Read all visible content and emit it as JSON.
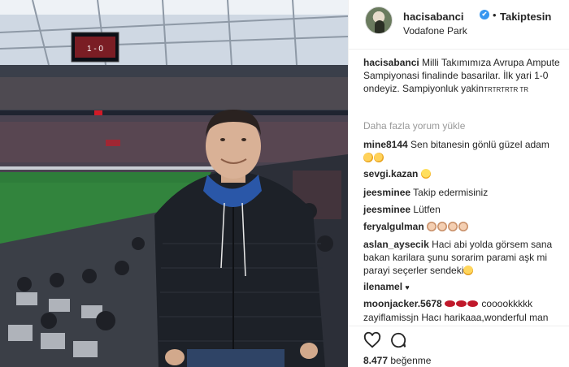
{
  "post": {
    "author": {
      "username": "hacisabanci",
      "follow_status": "Takiptesin",
      "separator": "•",
      "location": "Vodafone Park",
      "verified_badge": "✔"
    },
    "caption": {
      "username": "hacisabanci",
      "text": "Milli Takımımıza Avrupa Ampute Sampiyonasi finalinde basarilar. İlk yari 1-0 ondeyiz. Sampiyonluk yakin",
      "trailing_tags": "TRTRTRTR TR"
    },
    "load_more_comments": "Daha fazla yorum yükle",
    "comments": [
      {
        "username": "mine8144",
        "text": "Sen bitanesin gönlü güzel adam",
        "emoji": [
          "clap",
          "clap"
        ]
      },
      {
        "username": "sevgi.kazan",
        "text": "",
        "emoji": [
          "smile"
        ]
      },
      {
        "username": "jeesminee",
        "text": "Takip edermisiniz",
        "emoji": []
      },
      {
        "username": "jeesminee",
        "text": "Lütfen",
        "emoji": []
      },
      {
        "username": "feryalgulman",
        "text": "",
        "emoji": [
          "hands",
          "hands",
          "hands",
          "hands"
        ]
      },
      {
        "username": "aslan_aysecik",
        "text": "Haci abi yolda görsem sana bakan karilara şunu sorarim parami aşk mi parayi seçerler sendeki",
        "emoji": [
          "laugh"
        ]
      },
      {
        "username": "ilenamel",
        "text": "♥",
        "emoji": []
      },
      {
        "username": "moonjacker.5678",
        "text": "cooookkkkk",
        "emoji": [
          "lips",
          "lips",
          "lips"
        ]
      },
      {
        "username": "zayiflamissjn",
        "text": "Hacı harikaaa,wonderful man",
        "emoji": []
      }
    ],
    "actions": {
      "like_icon": "heart-outline-icon",
      "comment_icon": "speech-bubble-icon"
    },
    "likes": {
      "count": "8.477",
      "label": "beğenme"
    },
    "photo": {
      "scoreboard_text": "1 - 0"
    }
  },
  "colors": {
    "verified": "#3897f0",
    "text": "#262626",
    "muted": "#999999",
    "pitch": "#2e7d3a"
  }
}
